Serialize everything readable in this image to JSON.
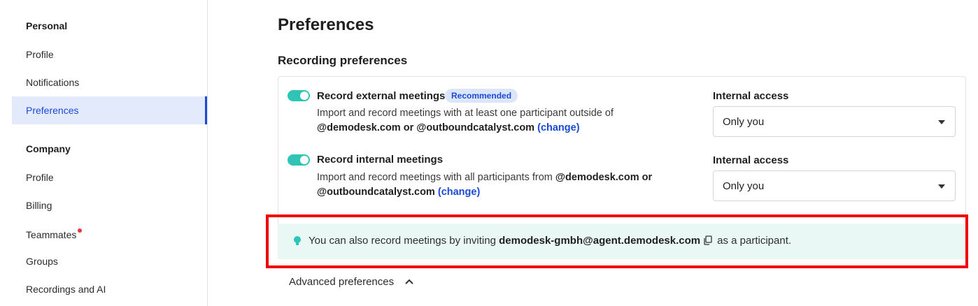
{
  "sidebar": {
    "personal_heading": "Personal",
    "personal_items": [
      {
        "label": "Profile"
      },
      {
        "label": "Notifications"
      },
      {
        "label": "Preferences"
      }
    ],
    "company_heading": "Company",
    "company_items": [
      {
        "label": "Profile"
      },
      {
        "label": "Billing"
      },
      {
        "label": "Teammates"
      },
      {
        "label": "Groups"
      },
      {
        "label": "Recordings and AI"
      }
    ]
  },
  "main": {
    "title": "Preferences",
    "section_title": "Recording preferences",
    "external": {
      "title": "Record external meetings",
      "badge": "Recommended",
      "desc_text": "Import and record meetings with at least one participant outside of",
      "desc_domains": "@demodesk.com or @outboundcatalyst.com",
      "change_link": "(change)",
      "access_label": "Internal access",
      "access_value": "Only you",
      "enabled": true
    },
    "internal": {
      "title": "Record internal meetings",
      "desc_text": "Import and record meetings with all participants from",
      "desc_domain1": "@demodesk.com or",
      "desc_domain2": "@outboundcatalyst.com",
      "change_link": "(change)",
      "access_label": "Internal access",
      "access_value": "Only you",
      "enabled": true
    },
    "info": {
      "prefix": "You can also record meetings by inviting",
      "email": "demodesk-gmbh@agent.demodesk.com",
      "suffix": "as a participant."
    },
    "advanced_label": "Advanced preferences"
  },
  "colors": {
    "accent": "#1a4ad6",
    "toggle_on": "#2ec4b6",
    "info_bg": "#e9f8f5",
    "highlight": "#f00000",
    "notification_dot": "#e53935"
  },
  "icons": {
    "bulb": "lightbulb-icon",
    "copy": "copy-icon",
    "chevron": "chevron-up-icon",
    "caret": "caret-down-icon"
  }
}
